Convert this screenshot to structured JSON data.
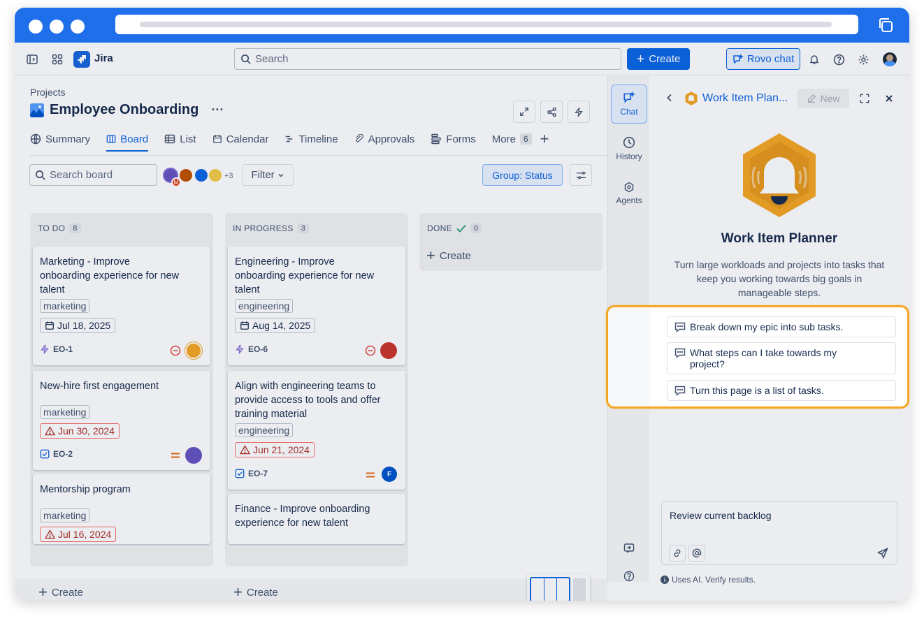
{
  "nav": {
    "app_name": "Jira",
    "search_placeholder": "Search",
    "create_label": "Create",
    "rovo_label": "Rovo chat"
  },
  "project": {
    "breadcrumb": "Projects",
    "title": "Employee Onboarding",
    "more_dots": "···"
  },
  "tabs": [
    {
      "label": "Summary",
      "icon": "globe-icon"
    },
    {
      "label": "Board",
      "icon": "board-icon"
    },
    {
      "label": "List",
      "icon": "list-icon"
    },
    {
      "label": "Calendar",
      "icon": "calendar-icon"
    },
    {
      "label": "Timeline",
      "icon": "timeline-icon"
    },
    {
      "label": "Approvals",
      "icon": "approvals-icon"
    },
    {
      "label": "Forms",
      "icon": "forms-icon"
    },
    {
      "label": "More",
      "icon": "more-icon",
      "count": "6"
    }
  ],
  "toolbar": {
    "search_board_placeholder": "Search board",
    "avatar_extra": "+3",
    "filter_label": "Filter",
    "group_label": "Group: Status"
  },
  "columns": [
    {
      "title": "TO DO",
      "count": "8",
      "create_label": "Create",
      "cards": [
        {
          "title": "Marketing - Improve onboarding experience for new talent",
          "label": "marketing",
          "date": "Jul 18, 2025",
          "key": "EO-1",
          "overdue": false
        },
        {
          "title": "New-hire first engagement",
          "label": "marketing",
          "date": "Jun 30, 2024",
          "key": "EO-2",
          "overdue": true
        },
        {
          "title": "Mentorship program",
          "label": "marketing",
          "date": "Jul 16, 2024",
          "overdue": true
        }
      ]
    },
    {
      "title": "IN PROGRESS",
      "count": "3",
      "create_label": "Create",
      "cards": [
        {
          "title": "Engineering - Improve onboarding experience for new talent",
          "label": "engineering",
          "date": "Aug 14, 2025",
          "key": "EO-6",
          "overdue": false
        },
        {
          "title": "Align with engineering teams to provide access to tools and offer training material",
          "label": "engineering",
          "date": "Jun 21, 2024",
          "key": "EO-7",
          "overdue": true,
          "avatar_initial": "F"
        },
        {
          "title": "Finance - Improve onboarding experience for new talent"
        }
      ]
    },
    {
      "title": "DONE",
      "count": "0",
      "create_label": "Create",
      "cards": []
    }
  ],
  "rail": {
    "chat": "Chat",
    "history": "History",
    "agents": "Agents"
  },
  "panel": {
    "title": "Work Item Plan...",
    "new_label": "New",
    "agent_name": "Work Item Planner",
    "agent_desc": "Turn large workloads and projects into tasks that keep you working towards big goals in manageable steps.",
    "suggestions": [
      "Break down my epic into sub tasks.",
      "What steps can I take towards my project?",
      "Turn this page is a list of tasks."
    ],
    "chat_value": "Review current backlog",
    "disclaimer": "Uses AI. Verify results."
  },
  "colors": {
    "chrome": "#1f6feb",
    "brand": "#0c66e4",
    "highlight": "#f5a623",
    "overdue": "#ae2e24"
  }
}
